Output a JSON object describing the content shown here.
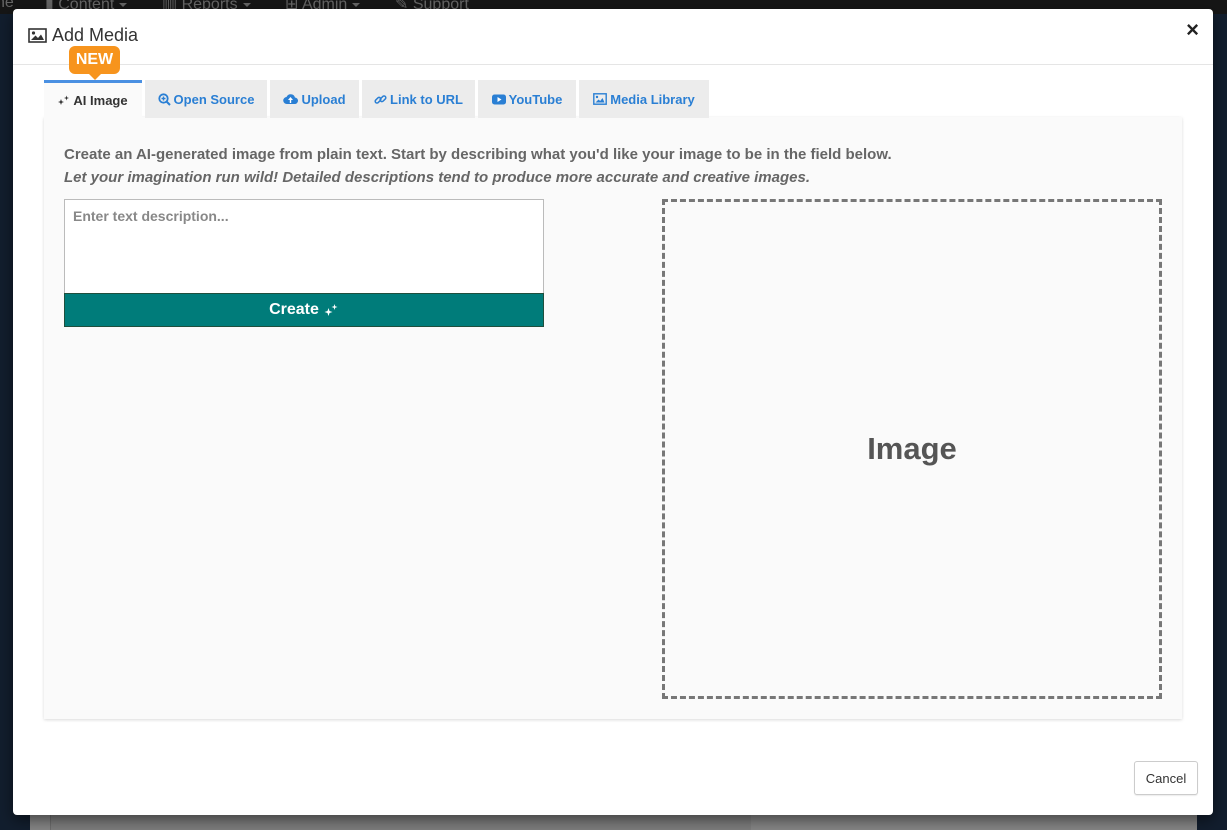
{
  "background_nav": {
    "items": [
      {
        "label": "ne",
        "icon": ""
      },
      {
        "label": "Content",
        "icon": "file-icon"
      },
      {
        "label": "Reports",
        "icon": "bar-chart-icon"
      },
      {
        "label": "Admin",
        "icon": "sitemap-icon"
      },
      {
        "label": "Support",
        "icon": "wrench-icon"
      }
    ]
  },
  "modal": {
    "title": "Add Media",
    "title_icon": "image-icon",
    "close_label": "×",
    "badge": "NEW",
    "tabs": [
      {
        "label": "AI Image",
        "icon": "sparkle-icon",
        "active": true
      },
      {
        "label": "Open Source",
        "icon": "search-plus-icon",
        "active": false
      },
      {
        "label": "Upload",
        "icon": "cloud-upload-icon",
        "active": false
      },
      {
        "label": "Link to URL",
        "icon": "link-icon",
        "active": false
      },
      {
        "label": "YouTube",
        "icon": "youtube-icon",
        "active": false
      },
      {
        "label": "Media Library",
        "icon": "image-icon",
        "active": false
      }
    ],
    "ai_image": {
      "description": "Create an AI-generated image from plain text. Start by describing what you'd like your image to be in the field below.",
      "hint": "Let your imagination run wild! Detailed descriptions tend to produce more accurate and creative images.",
      "input_placeholder": "Enter text description...",
      "input_value": "",
      "create_label": "Create",
      "create_icon": "sparkle-icon",
      "image_placeholder": "Image"
    },
    "cancel_label": "Cancel"
  },
  "colors": {
    "accent_blue": "#2a7fd4",
    "badge_orange": "#f7941d",
    "create_teal": "#007c7a"
  }
}
